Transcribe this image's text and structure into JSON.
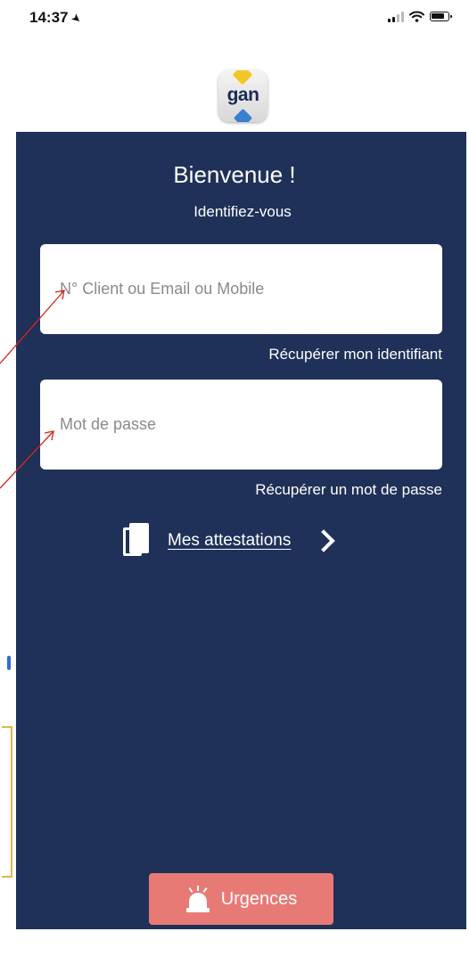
{
  "status_bar": {
    "time": "14:37",
    "location_arrow_icon": "location-arrow-icon"
  },
  "logo": {
    "text": "gan"
  },
  "login": {
    "title": "Bienvenue !",
    "subtitle": "Identifiez-vous",
    "identifier_placeholder": "N° Client ou Email ou Mobile",
    "identifier_value": "",
    "recover_identifier": "Récupérer mon identifiant",
    "password_placeholder": "Mot de passe",
    "password_value": "",
    "recover_password": "Récupérer un mot de passe",
    "attestations_label": "Mes attestations"
  },
  "footer": {
    "urgences_label": "Urgences"
  },
  "colors": {
    "panel_bg": "#1f3159",
    "urgences_bg": "#e87a76",
    "annotation_red": "#d9241b"
  },
  "icons": [
    "location-arrow-icon",
    "signal-icon",
    "wifi-icon",
    "battery-icon",
    "documents-icon",
    "chevron-right-icon",
    "siren-icon"
  ]
}
